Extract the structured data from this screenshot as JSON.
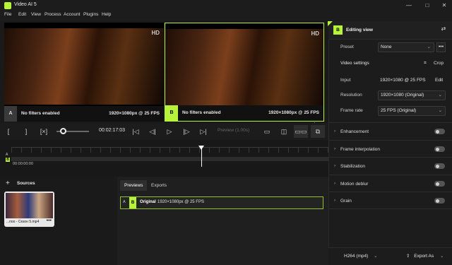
{
  "window": {
    "title": "Video AI 5",
    "minimize": "—",
    "maximize": "□",
    "close": "✕"
  },
  "menu": [
    "File",
    "Edit",
    "View",
    "Process",
    "Account",
    "Plugins",
    "Help"
  ],
  "previews": {
    "left": {
      "badge": "A",
      "filter_text": "No filters enabled",
      "resolution": "1920×1080px @ 25 FPS",
      "channel_logo": "HD"
    },
    "right": {
      "badge": "B",
      "filter_text": "No filters enabled",
      "resolution": "1920×1080px @ 25 FPS",
      "channel_logo": "HD"
    }
  },
  "transport": {
    "timecode": "00:02:17:03",
    "preview_label": "Preview (1.00s)",
    "volume_level": 0.2
  },
  "timeline": {
    "track_a": "A",
    "track_b": "B",
    "time": "00:00:00:00",
    "playhead_fraction": 0.6
  },
  "sources": {
    "title": "Sources",
    "add": "+",
    "card": {
      "name": "...поо - Сезон 5.mp4",
      "more": "•••"
    }
  },
  "list": {
    "tabs": [
      "Previews",
      "Exports"
    ],
    "row": {
      "a": "A",
      "b": "B",
      "label": "Original",
      "info": "1920×1080px @ 25 FPS"
    }
  },
  "right_panel": {
    "badge": "B",
    "title": "Editing view",
    "preset_label": "Preset",
    "preset_value": "None",
    "preset_more": "•••",
    "video_settings": "Video settings",
    "crop": "Crop",
    "input_label": "Input",
    "input_value": "1920×1080 @ 25 FPS",
    "edit": "Edit",
    "resolution_label": "Resolution",
    "resolution_value": "1920×1080 (Original)",
    "framerate_label": "Frame rate",
    "framerate_value": "25 FPS (Original)",
    "sections": [
      "Enhancement",
      "Frame interpolation",
      "Stabilization",
      "Motion deblur",
      "Grain"
    ]
  },
  "export": {
    "format": "H264 (mp4)",
    "button": "Export As"
  },
  "colors": {
    "accent": "#b7f33a",
    "background": "#141414",
    "panel": "#1c1c1c"
  }
}
